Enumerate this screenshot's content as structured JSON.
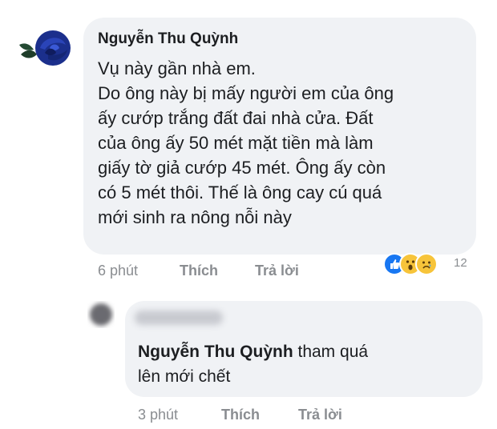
{
  "comment": {
    "author": "Nguyễn Thu Quỳnh",
    "lines": [
      "Vụ này gần nhà em.",
      "Do ông này bị mấy người em của ông",
      "ấy cướp trắng đất đai nhà cửa. Đất",
      "của ông ấy 50 mét mặt tiền mà làm",
      "giấy tờ giả cướp 45 mét. Ông ấy còn",
      "có 5 mét thôi. Thế là ông cay cú quá",
      "mới sinh ra nông nỗi này"
    ],
    "time": "6 phút",
    "like_label": "Thích",
    "reply_label": "Trả lời",
    "reaction_count": "12",
    "reaction_icons": [
      "like-icon",
      "wow-icon",
      "sad-icon"
    ]
  },
  "reply": {
    "mention": "Nguyễn Thu Quỳnh",
    "text_after_mention": " tham quá",
    "line2": "lên mới chết",
    "time": "3 phút",
    "like_label": "Thích",
    "reply_label": "Trả lời"
  },
  "colors": {
    "bubble": "#f0f2f5",
    "meta_text": "#8a8d91",
    "like_blue": "#1877f2",
    "emoji_yellow": "#f7c43a"
  }
}
